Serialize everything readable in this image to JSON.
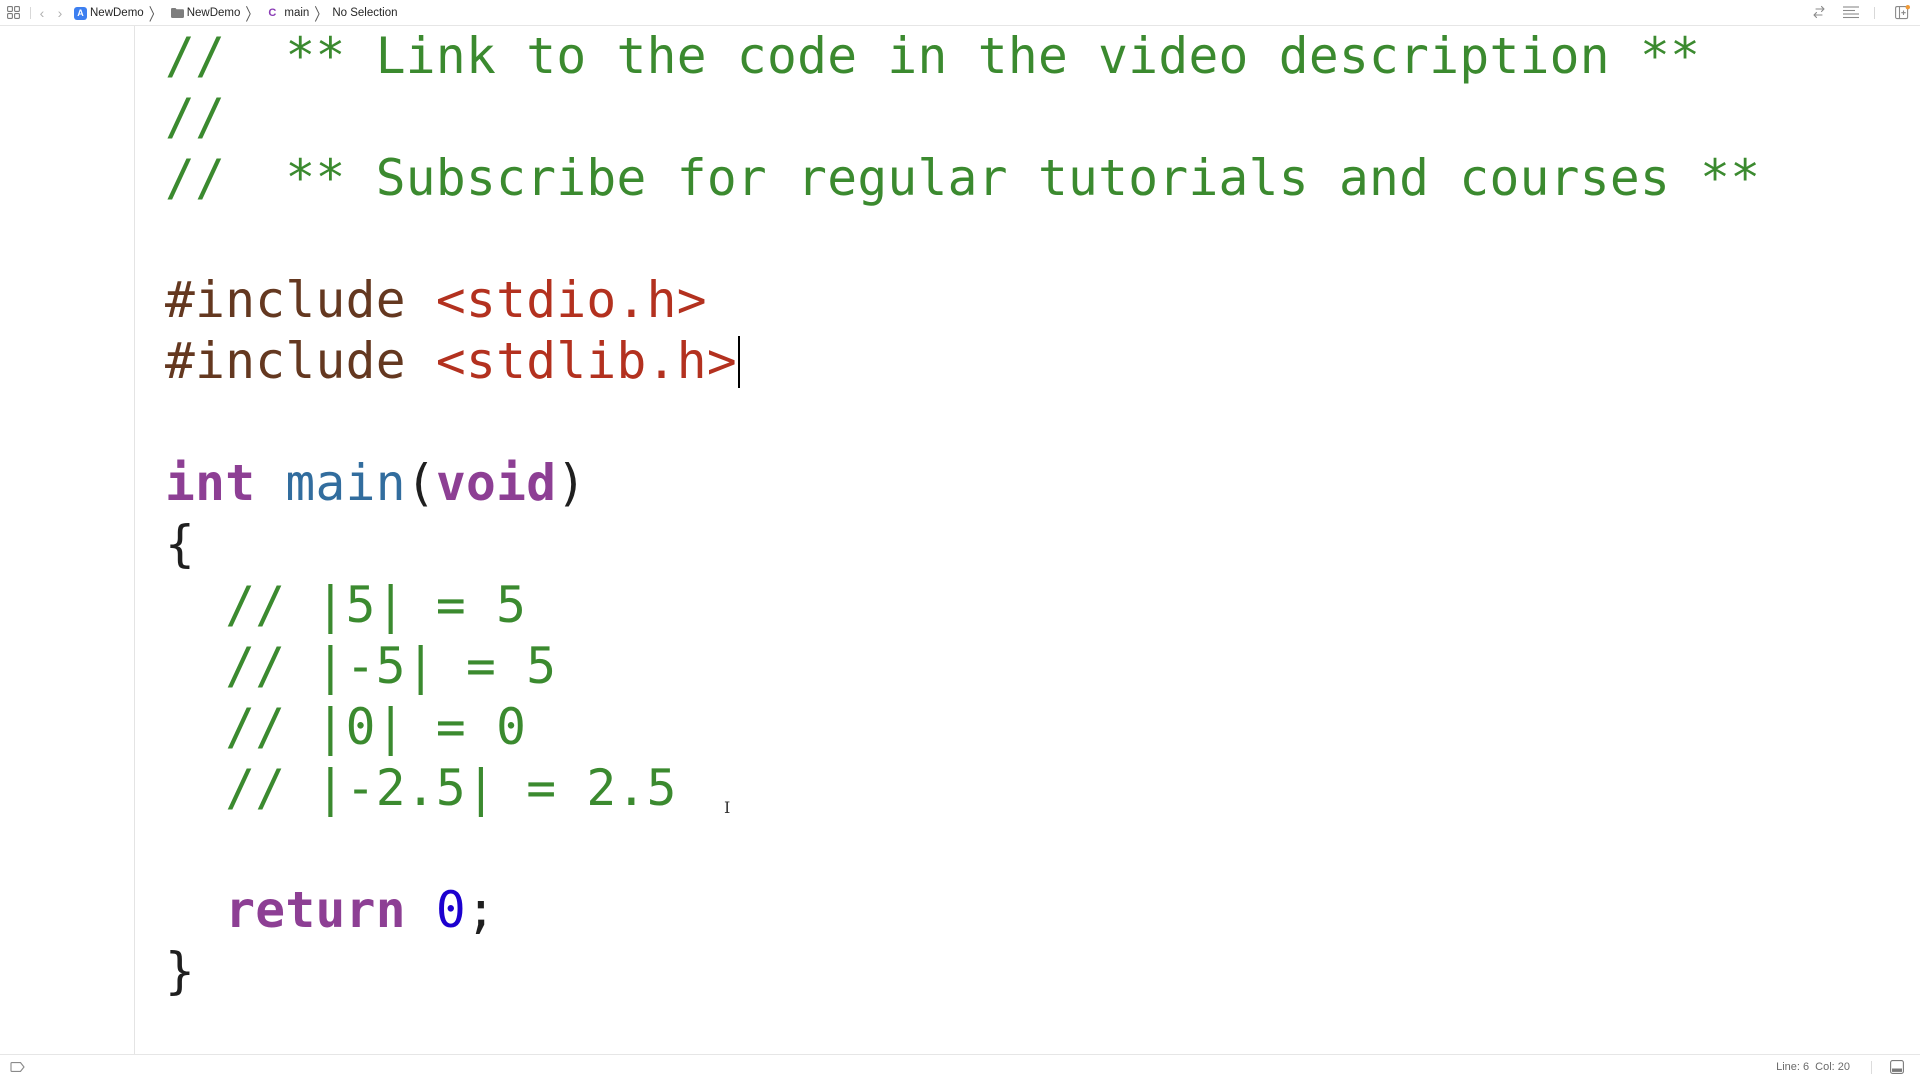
{
  "topbar": {
    "icons": {
      "grid": "related-items-grid-icon",
      "back": "chevron-left-icon",
      "forward": "chevron-right-icon",
      "app": "xcode-app-icon",
      "folder": "folder-icon",
      "c_file": "c-file-icon",
      "swap": "swap-arrows-icon",
      "lines": "editor-options-lines-icon",
      "add_editor": "add-editor-icon"
    },
    "back_glyph": "‹",
    "forward_glyph": "›",
    "app_glyph": "A",
    "c_glyph": "C",
    "chevron_glyph": "〉",
    "breadcrumbs": [
      {
        "label": "NewDemo",
        "type": "project"
      },
      {
        "label": "NewDemo",
        "type": "folder"
      },
      {
        "label": "main",
        "type": "c-file"
      },
      {
        "label": "No Selection",
        "type": "symbol"
      }
    ]
  },
  "editor": {
    "lines": [
      [
        {
          "t": "cm",
          "v": "//  ** Link to the code in the video description **"
        }
      ],
      [
        {
          "t": "cm",
          "v": "//"
        }
      ],
      [
        {
          "t": "cm",
          "v": "//  ** Subscribe for regular tutorials and courses **"
        }
      ],
      [],
      [
        {
          "t": "pp",
          "v": "#include "
        },
        {
          "t": "str",
          "v": "<stdio.h>"
        }
      ],
      [
        {
          "t": "pp",
          "v": "#include "
        },
        {
          "t": "str",
          "v": "<stdlib.h>"
        }
      ],
      [],
      [
        {
          "t": "kw2",
          "v": "int"
        },
        {
          "t": "pl",
          "v": " "
        },
        {
          "t": "fn",
          "v": "main"
        },
        {
          "t": "pl",
          "v": "("
        },
        {
          "t": "kw2",
          "v": "void"
        },
        {
          "t": "pl",
          "v": ")"
        }
      ],
      [
        {
          "t": "pl",
          "v": "{"
        }
      ],
      [
        {
          "t": "cm",
          "v": "  // |5| = 5"
        }
      ],
      [
        {
          "t": "cm",
          "v": "  // |-5| = 5"
        }
      ],
      [
        {
          "t": "cm",
          "v": "  // |0| = 0"
        }
      ],
      [
        {
          "t": "cm",
          "v": "  // |-2.5| = 2.5"
        }
      ],
      [],
      [
        {
          "t": "pl",
          "v": "  "
        },
        {
          "t": "kw2",
          "v": "return"
        },
        {
          "t": "pl",
          "v": " "
        },
        {
          "t": "num",
          "v": "0"
        },
        {
          "t": "pl",
          "v": ";"
        }
      ],
      [
        {
          "t": "pl",
          "v": "}"
        }
      ]
    ],
    "caret_line": 6,
    "ibeam_glyph": "I"
  },
  "statusbar": {
    "line_label": "Line: 6",
    "col_label": "Col: 20",
    "icons": {
      "tag": "tag-icon",
      "debug_area": "debug-area-toggle-icon"
    }
  },
  "colors": {
    "comment": "#3b8a2f",
    "preprocessor": "#643820",
    "string": "#b3311f",
    "keyword": "#8d3f94",
    "function": "#326d9e",
    "number": "#1c00cf",
    "plain": "#1f1f1f"
  }
}
